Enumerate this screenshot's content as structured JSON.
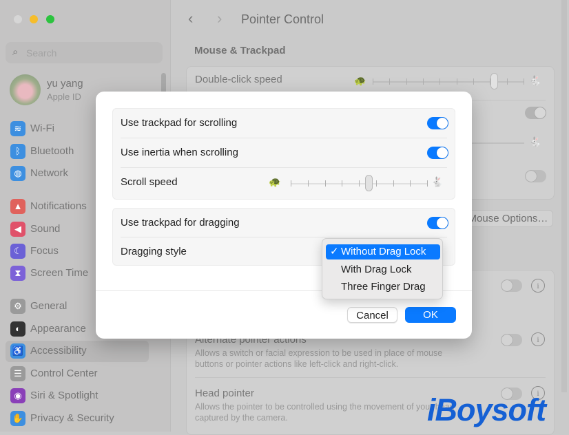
{
  "window": {
    "controls": [
      "close",
      "minimize",
      "zoom"
    ]
  },
  "sidebar": {
    "search_placeholder": "Search",
    "user": {
      "name": "yu yang",
      "subtitle": "Apple ID"
    },
    "items": [
      {
        "label": "Wi-Fi",
        "icon": "wifi-icon",
        "color": "#3d8fe0",
        "glyph": "≋"
      },
      {
        "label": "Bluetooth",
        "icon": "bluetooth-icon",
        "color": "#3d8fe0",
        "glyph": "ᛒ"
      },
      {
        "label": "Network",
        "icon": "globe-icon",
        "color": "#3d8fe0",
        "glyph": "◍"
      },
      {
        "label": "Notifications",
        "icon": "bell-icon",
        "color": "#e0625c",
        "glyph": "▲"
      },
      {
        "label": "Sound",
        "icon": "speaker-icon",
        "color": "#e0526a",
        "glyph": "◀"
      },
      {
        "label": "Focus",
        "icon": "moon-icon",
        "color": "#6b61d6",
        "glyph": "☾"
      },
      {
        "label": "Screen Time",
        "icon": "hourglass-icon",
        "color": "#7c62d8",
        "glyph": "⧗"
      },
      {
        "label": "General",
        "icon": "gear-icon",
        "color": "#9a9a9a",
        "glyph": "⚙"
      },
      {
        "label": "Appearance",
        "icon": "appearance-icon",
        "color": "#333333",
        "glyph": "◐"
      },
      {
        "label": "Accessibility",
        "icon": "accessibility-icon",
        "color": "#3d8fe0",
        "glyph": "♿",
        "selected": true
      },
      {
        "label": "Control Center",
        "icon": "control-center-icon",
        "color": "#9a9a9a",
        "glyph": "☰"
      },
      {
        "label": "Siri & Spotlight",
        "icon": "siri-icon",
        "color": "#8a3fb8",
        "glyph": "◉"
      },
      {
        "label": "Privacy & Security",
        "icon": "hand-icon",
        "color": "#3d8fe0",
        "glyph": "✋"
      }
    ]
  },
  "main": {
    "title": "Pointer Control",
    "section": "Mouse & Trackpad",
    "double_click_label": "Double-click speed",
    "double_click_value": 0.8,
    "mouse_options_label": "Mouse Options…",
    "alternate": {
      "title": "Alternate pointer actions",
      "desc1": "Allows a switch or facial expression to be used in place of mouse",
      "desc2": "buttons or pointer actions like left-click and right-click."
    },
    "head": {
      "title": "Head pointer",
      "desc1": "Allows the pointer to be controlled using the movement of your head",
      "desc2": "captured by the camera."
    }
  },
  "dialog": {
    "rows": {
      "scrolling": "Use trackpad for scrolling",
      "inertia": "Use inertia when scrolling",
      "scroll_speed": "Scroll speed",
      "dragging": "Use trackpad for dragging",
      "dragging_style": "Dragging style"
    },
    "toggles": {
      "scrolling": true,
      "inertia": true,
      "dragging": true
    },
    "scroll_speed_value": 0.57,
    "cancel": "Cancel",
    "ok": "OK",
    "popup": {
      "options": [
        "Without Drag Lock",
        "With Drag Lock",
        "Three Finger Drag"
      ],
      "selected": "Without Drag Lock",
      "check": "✓"
    }
  },
  "watermark": "iBoysoft",
  "colors": {
    "accent": "#0a7aff"
  }
}
